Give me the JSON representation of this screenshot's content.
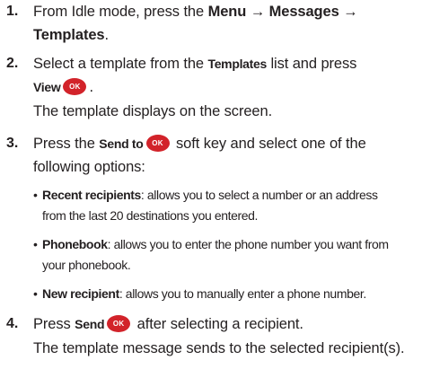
{
  "steps": [
    {
      "number": "1.",
      "text_a": "From Idle mode, press the ",
      "bold_a": "Menu → Messages →",
      "bold_b": "Templates",
      "text_b": "."
    },
    {
      "number": "2.",
      "text_a": "Select a template from the ",
      "cond_a": "Templates",
      "text_b": " list and press",
      "cond_b": "View",
      "ok_label": "OK",
      "text_c": ".",
      "followup": "The template displays on the screen."
    },
    {
      "number": "3.",
      "text_a": "Press the ",
      "cond_a": "Send to",
      "ok_label": "OK",
      "text_b": " soft key and select one of the",
      "text_c": "following options:",
      "bullets": [
        {
          "term": "Recent recipients",
          "desc_a": ": allows you to select a number or an address",
          "desc_b": "from the last 20 destinations you entered."
        },
        {
          "term": "Phonebook",
          "desc_a": ": allows you to enter the phone number you want from",
          "desc_b": "your phonebook."
        },
        {
          "term": "New recipient",
          "desc_a": ": allows you to manually enter a phone number."
        }
      ]
    },
    {
      "number": "4.",
      "text_a": "Press ",
      "cond_a": "Send",
      "ok_label": "OK",
      "text_b": " after selecting a recipient.",
      "followup": "The template message sends to the selected recipient(s)."
    }
  ],
  "bullet_glyph": "•",
  "colors": {
    "text": "#231f20",
    "ok_button": "#d2232a"
  }
}
